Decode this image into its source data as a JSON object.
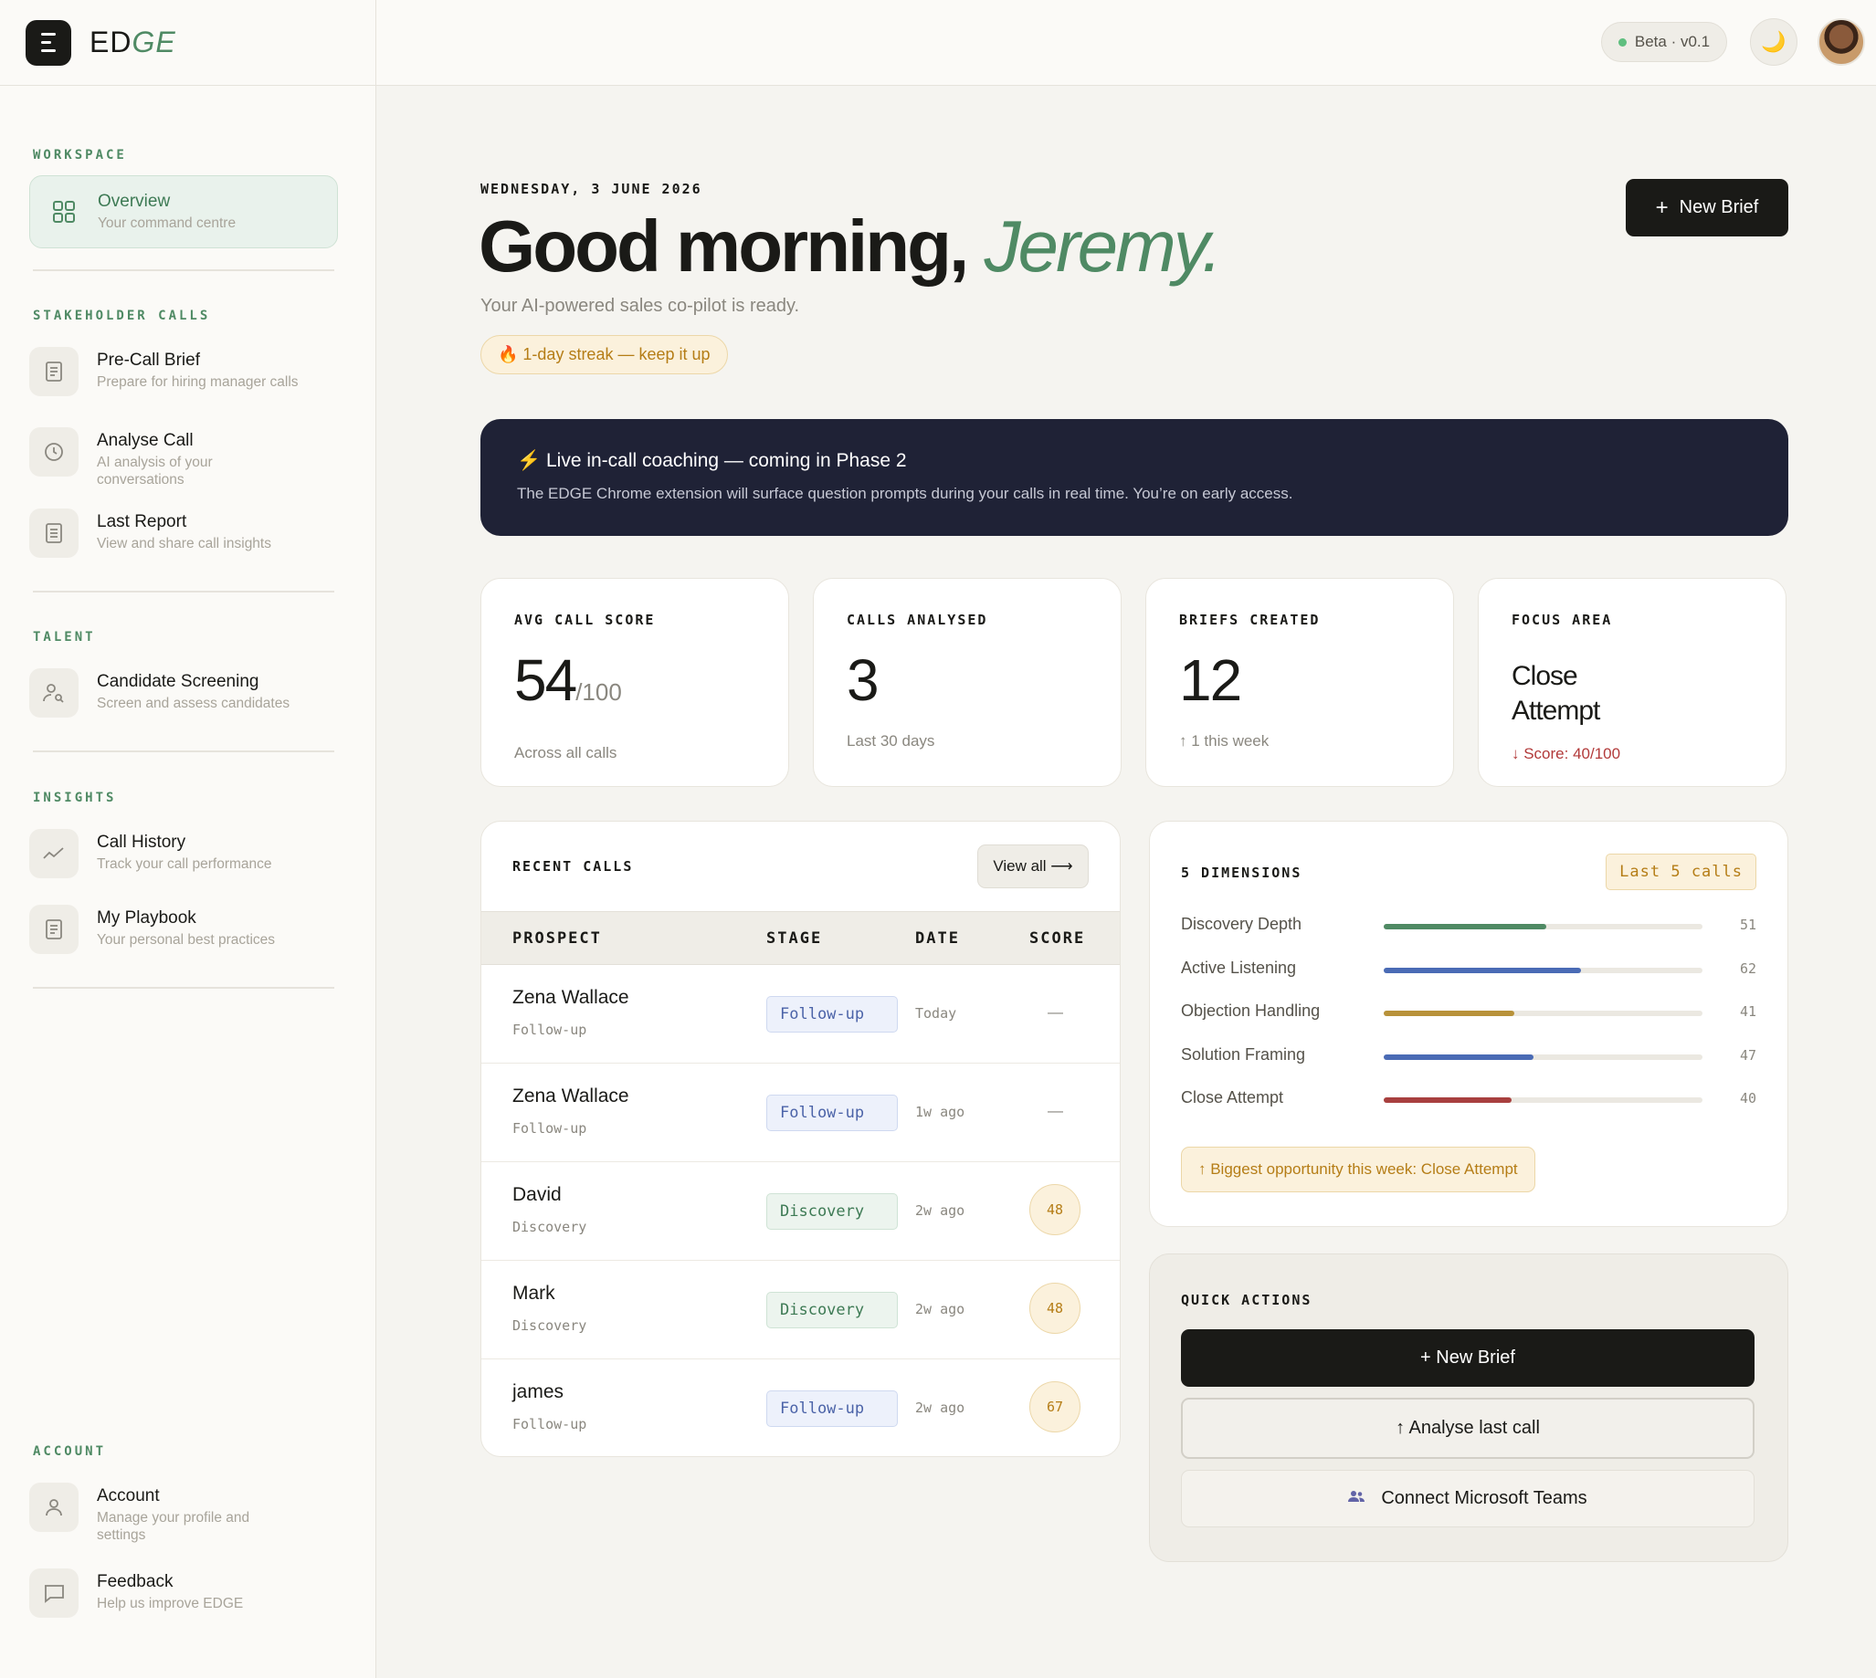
{
  "brand": {
    "name_part1": "ED",
    "name_part2": "GE"
  },
  "sidebar": {
    "sections": {
      "workspace": "WORKSPACE",
      "stakeholder": "STAKEHOLDER CALLS",
      "talent": "TALENT",
      "insights": "INSIGHTS",
      "account": "ACCOUNT"
    },
    "items": {
      "overview": {
        "label": "Overview",
        "sub": "Your command centre",
        "icon": "grid-icon"
      },
      "precall": {
        "label": "Pre-Call Brief",
        "sub": "Prepare for hiring manager calls",
        "icon": "document-icon"
      },
      "analyse": {
        "label": "Analyse Call",
        "sub": "AI analysis of your conversations",
        "icon": "clock-icon"
      },
      "report": {
        "label": "Last Report",
        "sub": "View and share call insights",
        "icon": "report-icon"
      },
      "screening": {
        "label": "Candidate Screening",
        "sub": "Screen and assess candidates",
        "icon": "user-search-icon"
      },
      "history": {
        "label": "Call History",
        "sub": "Track your call performance",
        "icon": "trend-icon"
      },
      "playbook": {
        "label": "My Playbook",
        "sub": "Your personal best practices",
        "icon": "playbook-icon"
      },
      "account": {
        "label": "Account",
        "sub": "Manage your profile and settings",
        "icon": "user-icon"
      },
      "feedback": {
        "label": "Feedback",
        "sub": "Help us improve EDGE",
        "icon": "chat-icon"
      }
    }
  },
  "topbar": {
    "beta": "Beta · v0.1",
    "moon": "🌙"
  },
  "header": {
    "date": "WEDNESDAY, 3 JUNE 2026",
    "greeting": "Good morning,",
    "name": "Jeremy.",
    "subtitle": "Your AI-powered sales co-pilot is ready.",
    "streak": "🔥 1-day streak — keep it up",
    "new_brief": "New Brief"
  },
  "banner": {
    "title": "⚡ Live in-call coaching — coming in Phase 2",
    "body": "The EDGE Chrome extension will surface question prompts during your calls in real time. You’re on early access."
  },
  "stats": {
    "avg": {
      "label": "AVG CALL SCORE",
      "value": "54",
      "suffix": "/100",
      "note": "Across all calls"
    },
    "calls": {
      "label": "CALLS ANALYSED",
      "value": "3",
      "note": "Last 30 days"
    },
    "briefs": {
      "label": "BRIEFS CREATED",
      "value": "12",
      "note": "↑ 1 this week"
    },
    "focus": {
      "label": "FOCUS AREA",
      "value_line1": "Close",
      "value_line2": "Attempt",
      "note": "↓ Score: 40/100"
    }
  },
  "recent_calls": {
    "title": "RECENT CALLS",
    "view_all": "View all ⟶",
    "columns": [
      "PROSPECT",
      "STAGE",
      "DATE",
      "SCORE"
    ],
    "rows": [
      {
        "name": "Zena Wallace",
        "sub": "Follow-up",
        "stage": "Follow-up",
        "date": "Today",
        "score": "—"
      },
      {
        "name": "Zena Wallace",
        "sub": "Follow-up",
        "stage": "Follow-up",
        "date": "1w ago",
        "score": "—"
      },
      {
        "name": "David",
        "sub": "Discovery",
        "stage": "Discovery",
        "date": "2w ago",
        "score": "48"
      },
      {
        "name": "Mark",
        "sub": "Discovery",
        "stage": "Discovery",
        "date": "2w ago",
        "score": "48"
      },
      {
        "name": "james",
        "sub": "Follow-up",
        "stage": "Follow-up",
        "date": "2w ago",
        "score": "67"
      }
    ]
  },
  "dimensions": {
    "title": "5 DIMENSIONS",
    "badge": "Last 5 calls",
    "items": [
      {
        "name": "Discovery Depth",
        "value": "51",
        "pct": 51,
        "color": "#4f8a64"
      },
      {
        "name": "Active Listening",
        "value": "62",
        "pct": 62,
        "color": "#4a6bb5"
      },
      {
        "name": "Objection Handling",
        "value": "41",
        "pct": 41,
        "color": "#b8923a"
      },
      {
        "name": "Solution Framing",
        "value": "47",
        "pct": 47,
        "color": "#4a6bb5"
      },
      {
        "name": "Close Attempt",
        "value": "40",
        "pct": 40,
        "color": "#a8403f"
      }
    ],
    "opportunity": "↑ Biggest opportunity this week: Close Attempt"
  },
  "quick_actions": {
    "title": "QUICK ACTIONS",
    "new_brief": "+ New Brief",
    "analyse": "↑ Analyse last call",
    "teams": "Connect Microsoft Teams"
  },
  "colors": {
    "accent": "#4f8a64",
    "dark": "#1a1a17",
    "banner": "#1f2236",
    "amber": "#b57d16"
  }
}
